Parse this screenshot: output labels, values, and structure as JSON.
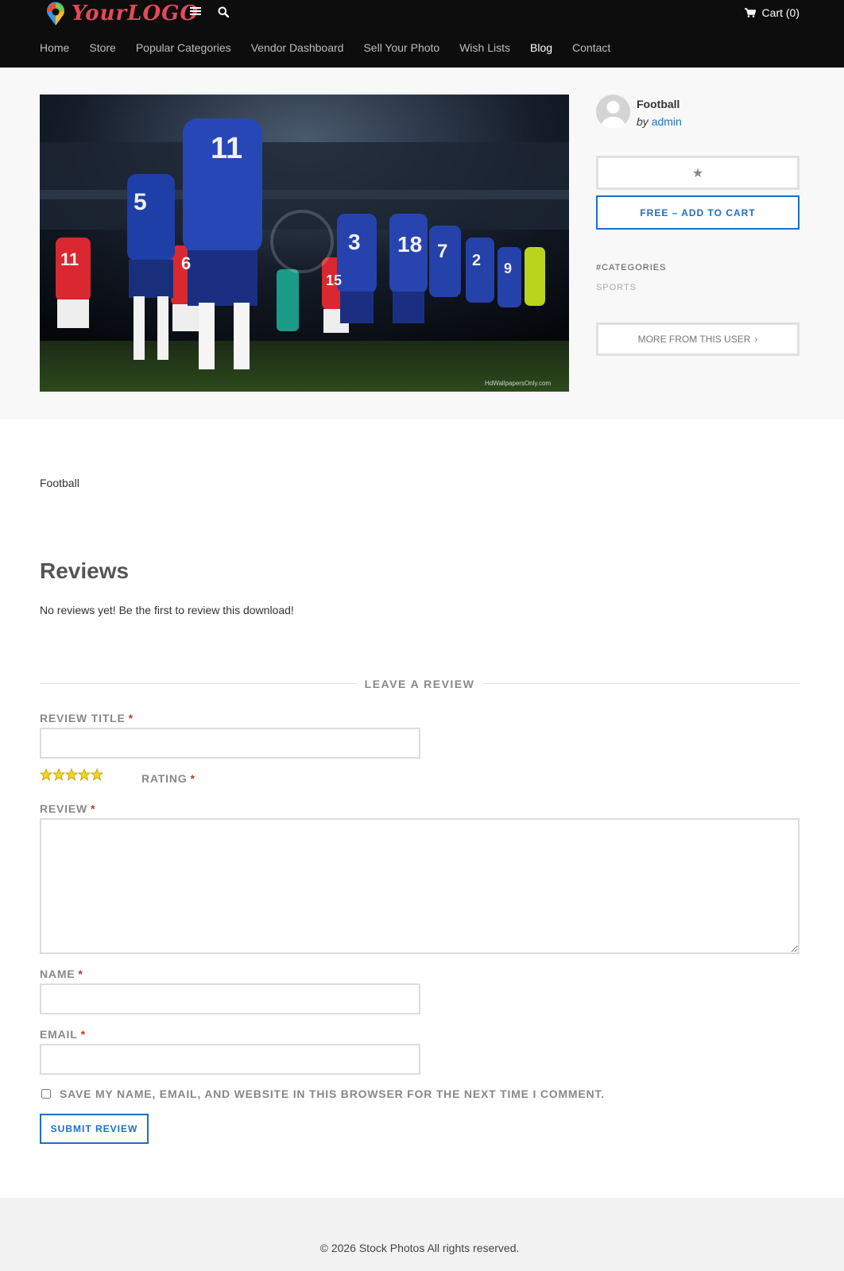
{
  "header": {
    "logo_text": "YourLOGO",
    "menu_icon": "hamburger-icon",
    "search_icon": "search-icon",
    "cart_label": "Cart (0)",
    "cart_icon": "shopping-cart-icon"
  },
  "nav": {
    "items": [
      {
        "label": "Home"
      },
      {
        "label": "Store"
      },
      {
        "label": "Popular Categories"
      },
      {
        "label": "Vendor Dashboard"
      },
      {
        "label": "Sell Your Photo"
      },
      {
        "label": "Wish Lists"
      },
      {
        "label": "Blog",
        "active": true
      },
      {
        "label": "Contact"
      }
    ]
  },
  "product": {
    "image_watermark": "HdWallpapersOnly.com",
    "title": "Football",
    "by_label": "by",
    "author": "admin",
    "favorite_icon": "star-icon",
    "add_to_cart_label": "FREE – ADD TO CART",
    "categories_heading": "#CATEGORIES",
    "category": "SPORTS",
    "more_label": "MORE FROM THIS USER"
  },
  "content": {
    "description": "Football",
    "reviews_title": "Reviews",
    "no_reviews": "No reviews yet! Be the first to review this download!"
  },
  "review_form": {
    "heading": "LEAVE A REVIEW",
    "title_label": "REVIEW TITLE",
    "rating_label": "RATING",
    "review_label": "REVIEW",
    "name_label": "NAME",
    "email_label": "EMAIL",
    "required_mark": "*",
    "rating_stars": 5,
    "consent_label": "SAVE MY NAME, EMAIL, AND WEBSITE IN THIS BROWSER FOR THE NEXT TIME I COMMENT.",
    "submit_label": "SUBMIT REVIEW"
  },
  "footer": {
    "copyright": "© 2026 Stock Photos All rights reserved."
  },
  "colors": {
    "accent": "#1e6fc4",
    "header_bg": "#0d0d0d",
    "logo": "#e14b5a",
    "required": "#c0392b"
  }
}
